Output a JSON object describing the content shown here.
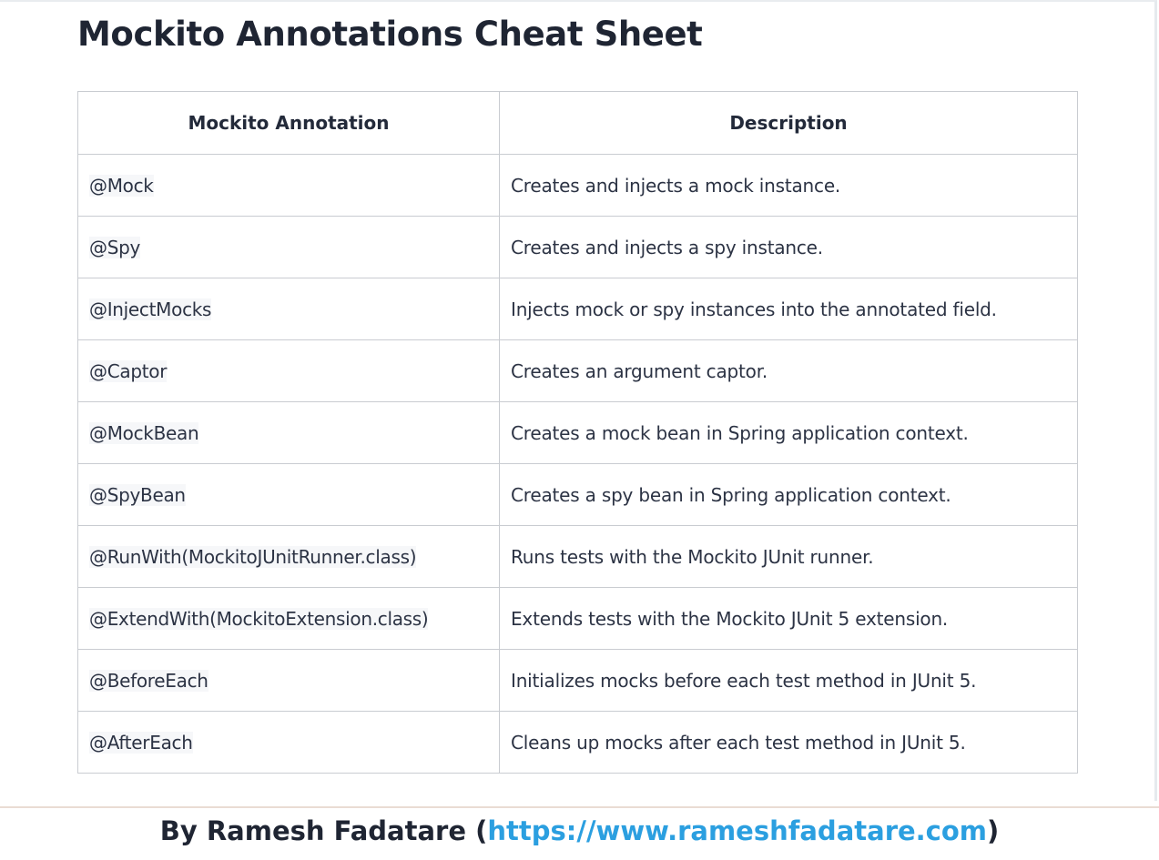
{
  "title": "Mockito Annotations Cheat Sheet",
  "table": {
    "headers": [
      "Mockito Annotation",
      "Description"
    ],
    "rows": [
      {
        "annotation": "@Mock",
        "description": "Creates and injects a mock instance."
      },
      {
        "annotation": "@Spy",
        "description": "Creates and injects a spy instance."
      },
      {
        "annotation": "@InjectMocks",
        "description": "Injects mock or spy instances into the annotated field."
      },
      {
        "annotation": "@Captor",
        "description": "Creates an argument captor."
      },
      {
        "annotation": "@MockBean",
        "description": "Creates a mock bean in Spring application context."
      },
      {
        "annotation": "@SpyBean",
        "description": "Creates a spy bean in Spring application context."
      },
      {
        "annotation": "@RunWith(MockitoJUnitRunner.class)",
        "description": "Runs tests with the Mockito JUnit runner."
      },
      {
        "annotation": "@ExtendWith(MockitoExtension.class)",
        "description": "Extends tests with the Mockito JUnit 5 extension."
      },
      {
        "annotation": "@BeforeEach",
        "description": "Initializes mocks before each test method in JUnit 5."
      },
      {
        "annotation": "@AfterEach",
        "description": "Cleans up mocks after each test method in JUnit 5."
      }
    ]
  },
  "footer": {
    "prefix": "By Ramesh Fadatare (",
    "link": "https://www.rameshfadatare.com",
    "suffix": ")"
  },
  "colors": {
    "link": "#2b9fe0",
    "text": "#2c3344",
    "border": "#c9ccd1"
  }
}
